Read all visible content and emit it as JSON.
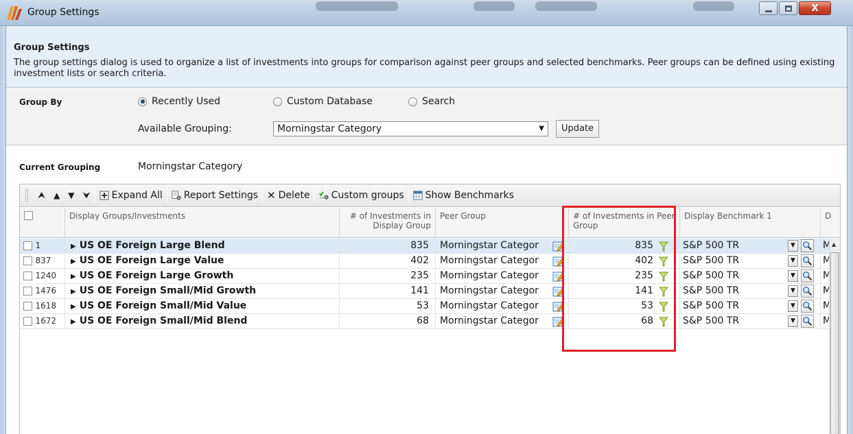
{
  "window": {
    "title": "Group Settings"
  },
  "description": {
    "heading": "Group Settings",
    "text": "The group settings dialog is used to organize a list of investments into groups for comparison against peer groups and selected benchmarks.  Peer groups can be defined using existing investment lists or search criteria."
  },
  "group_by": {
    "label": "Group By",
    "options": [
      "Recently Used",
      "Custom Database",
      "Search"
    ],
    "selected": "Recently Used",
    "available_label": "Available Grouping:",
    "available_value": "Morningstar Category",
    "update_label": "Update"
  },
  "current_grouping": {
    "label": "Current Grouping",
    "value": "Morningstar Category"
  },
  "toolbar": {
    "expand_all": "Expand All",
    "report_settings": "Report Settings",
    "delete": "Delete",
    "custom_groups": "Custom groups",
    "show_benchmarks": "Show Benchmarks"
  },
  "columns": {
    "display_groups": "Display Groups/Investments",
    "investments_in_display_group": "# of Investments in Display Group",
    "peer_group": "Peer Group",
    "investments_in_peer_group": "# of Investments in Peer Group",
    "display_benchmark_1": "Display Benchmark 1",
    "next_col": "D"
  },
  "rows": [
    {
      "index": "1",
      "name": "US OE Foreign Large Blend",
      "display_count": "835",
      "peer_group": "Morningstar Categor",
      "peer_count": "835",
      "benchmark": "S&P 500 TR",
      "next": "M"
    },
    {
      "index": "837",
      "name": "US OE Foreign Large Value",
      "display_count": "402",
      "peer_group": "Morningstar Categor",
      "peer_count": "402",
      "benchmark": "S&P 500 TR",
      "next": "M"
    },
    {
      "index": "1240",
      "name": "US OE Foreign Large Growth",
      "display_count": "235",
      "peer_group": "Morningstar Categor",
      "peer_count": "235",
      "benchmark": "S&P 500 TR",
      "next": "M"
    },
    {
      "index": "1476",
      "name": "US OE Foreign Small/Mid Growth",
      "display_count": "141",
      "peer_group": "Morningstar Categor",
      "peer_count": "141",
      "benchmark": "S&P 500 TR",
      "next": "M"
    },
    {
      "index": "1618",
      "name": "US OE Foreign Small/Mid Value",
      "display_count": "53",
      "peer_group": "Morningstar Categor",
      "peer_count": "53",
      "benchmark": "S&P 500 TR",
      "next": "M"
    },
    {
      "index": "1672",
      "name": "US OE Foreign Small/Mid Blend",
      "display_count": "68",
      "peer_group": "Morningstar Categor",
      "peer_count": "68",
      "benchmark": "S&P 500 TR",
      "next": "M"
    }
  ],
  "colors": {
    "highlight": "#e0202a",
    "selected_row": "#dde9f5",
    "header_band": "#e6eef7"
  }
}
